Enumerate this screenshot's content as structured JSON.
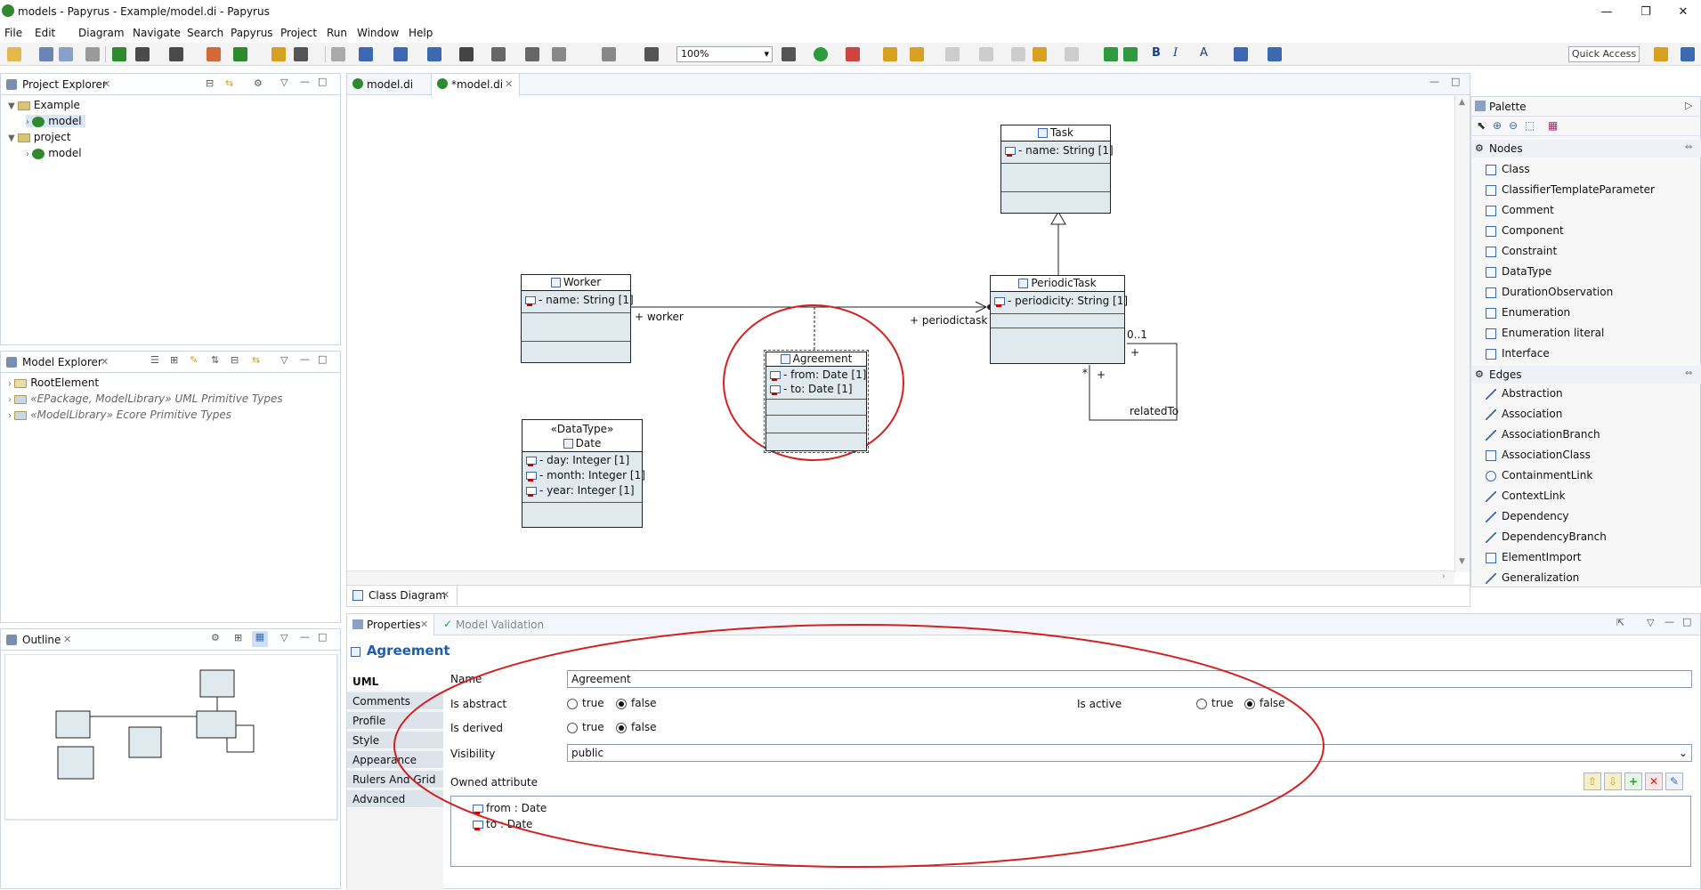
{
  "window": {
    "title": "models - Papyrus - Example/model.di - Papyrus"
  },
  "menu": [
    "File",
    "Edit",
    "Diagram",
    "Navigate",
    "Search",
    "Papyrus",
    "Project",
    "Run",
    "Window",
    "Help"
  ],
  "toolbar": {
    "zoom": "100%",
    "quick_access": "Quick Access",
    "bold": "B",
    "italic": "I",
    "font": "A"
  },
  "project_explorer": {
    "title": "Project Explorer",
    "items": [
      "Example",
      "model",
      "project",
      "model"
    ]
  },
  "model_explorer": {
    "title": "Model Explorer",
    "items": [
      "RootElement",
      "«EPackage, ModelLibrary» UML Primitive Types",
      "«ModelLibrary» Ecore Primitive Types"
    ]
  },
  "outline": {
    "title": "Outline"
  },
  "editor": {
    "tabs": [
      "model.di",
      "*model.di"
    ],
    "bottom_tab": "Class Diagram"
  },
  "diagram": {
    "task": {
      "name": "Task",
      "attrs": [
        "- name: String [1]"
      ]
    },
    "worker": {
      "name": "Worker",
      "attrs": [
        "- name: String [1]"
      ]
    },
    "periodic": {
      "name": "PeriodicTask",
      "attrs": [
        "- periodicity: String [1]"
      ]
    },
    "agreement": {
      "name": "Agreement",
      "attrs": [
        "- from: Date [1]",
        "- to: Date [1]"
      ]
    },
    "date": {
      "stereo": "«DataType»",
      "name": "Date",
      "attrs": [
        "- day: Integer [1]",
        "- month: Integer [1]",
        "- year: Integer [1]"
      ]
    },
    "labels": {
      "worker": "+ worker",
      "periodictask": "+ periodictask",
      "mult": "0..1",
      "plus1": "+",
      "star": "*",
      "plus2": "+",
      "related": "relatedTo"
    }
  },
  "palette": {
    "title": "Palette",
    "nodes_title": "Nodes",
    "nodes": [
      "Class",
      "ClassifierTemplateParameter",
      "Comment",
      "Component",
      "Constraint",
      "DataType",
      "DurationObservation",
      "Enumeration",
      "Enumeration literal",
      "Interface"
    ],
    "edges_title": "Edges",
    "edges": [
      "Abstraction",
      "Association",
      "AssociationBranch",
      "AssociationClass",
      "ContainmentLink",
      "ContextLink",
      "Dependency",
      "DependencyBranch",
      "ElementImport",
      "Generalization"
    ]
  },
  "properties": {
    "tab": "Properties",
    "tab2": "Model Validation",
    "heading": "Agreement",
    "side_tabs": [
      "UML",
      "Comments",
      "Profile",
      "Style",
      "Appearance",
      "Rulers And Grid",
      "Advanced"
    ],
    "name_label": "Name",
    "name_value": "Agreement",
    "abstract_label": "Is abstract",
    "derived_label": "Is derived",
    "active_label": "Is active",
    "true": "true",
    "false": "false",
    "visibility_label": "Visibility",
    "visibility_value": "public",
    "owned_label": "Owned attribute",
    "owned": [
      "from : Date",
      "to : Date"
    ]
  },
  "colors": {
    "accent": "#1f5fa8",
    "annotation": "#d62020",
    "class_fill": "#dfe9ee"
  }
}
